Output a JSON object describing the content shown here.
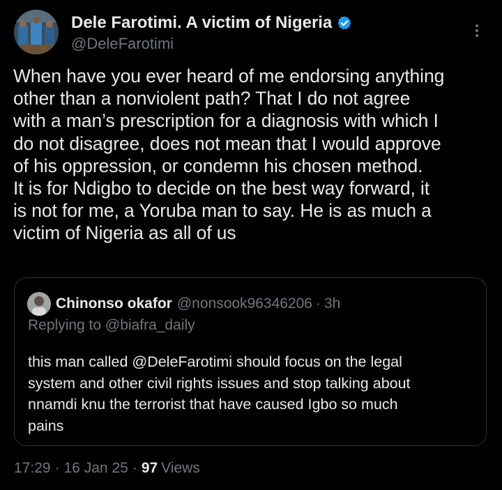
{
  "author": {
    "display_name": "Dele Farotimi. A victim of Nigeria",
    "handle": "@DeleFarotimi",
    "verified": true,
    "verified_color": "#1d9bf0"
  },
  "tweet": {
    "text": "When have you ever heard of me endorsing anything\nother than a nonviolent path? That I do not agree\nwith a man’s prescription for a diagnosis with which I\ndo not disagree, does not mean that I would approve\nof his oppression, or condemn his chosen method.\nIt is for Ndigbo to decide on the best way forward, it\nis not for me, a Yoruba man to say. He is as much a\nvictim of Nigeria as all of us"
  },
  "quoted": {
    "name": "Chinonso okafor",
    "handle": "@nonsook96346206",
    "separator": "·",
    "time": "3h",
    "replying_to": "Replying to @biafra_daily",
    "text": "this man called @DeleFarotimi  should focus on the legal\nsystem and other civil rights issues and stop talking about\nnnamdi knu the terrorist that have caused Igbo so much\npains"
  },
  "meta": {
    "time": "17:29",
    "sep1": "·",
    "date": "16 Jan 25",
    "sep2": "·",
    "views_count": "97",
    "views_label": "Views"
  },
  "icons": {
    "verified": "verified-badge-icon",
    "more": "more-options-icon"
  },
  "colors": {
    "background": "#000000",
    "text_primary": "#e7e9ea",
    "text_secondary": "#71767b",
    "border": "#2f3336",
    "accent": "#1d9bf0"
  }
}
